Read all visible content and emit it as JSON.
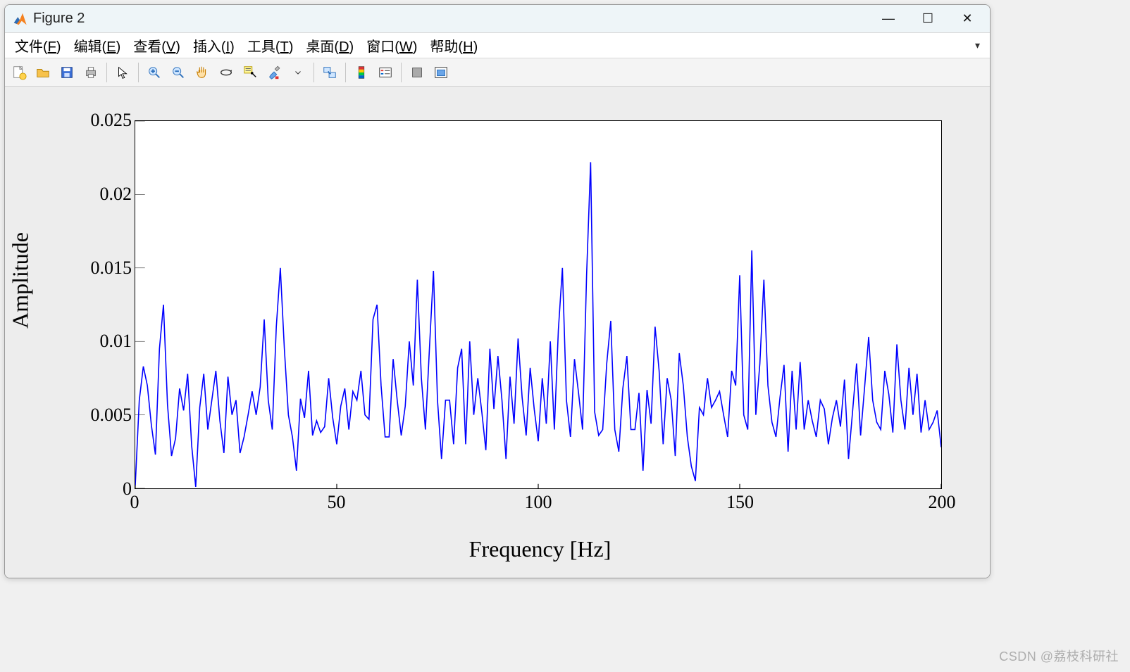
{
  "window": {
    "title": "Figure 2",
    "minimize": "—",
    "maximize": "☐",
    "close": "✕"
  },
  "menus": {
    "file": {
      "text": "文件(",
      "key": "F",
      "tail": ")"
    },
    "edit": {
      "text": "编辑(",
      "key": "E",
      "tail": ")"
    },
    "view": {
      "text": "查看(",
      "key": "V",
      "tail": ")"
    },
    "insert": {
      "text": "插入(",
      "key": "I",
      "tail": ")"
    },
    "tools": {
      "text": "工具(",
      "key": "T",
      "tail": ")"
    },
    "desktop": {
      "text": "桌面(",
      "key": "D",
      "tail": ")"
    },
    "windowm": {
      "text": "窗口(",
      "key": "W",
      "tail": ")"
    },
    "help": {
      "text": "帮助(",
      "key": "H",
      "tail": ")"
    }
  },
  "toolbar": {
    "new": "new-figure",
    "open": "open",
    "save": "save",
    "print": "print",
    "pointer": "pointer",
    "zoomin": "zoom-in",
    "zoomout": "zoom-out",
    "pan": "pan",
    "rotate": "rotate-3d",
    "datacursor": "data-cursor",
    "brush": "brush",
    "link": "link-plots",
    "colorbar": "insert-colorbar",
    "legend": "insert-legend",
    "hide": "hide-tools",
    "dock": "dock-figure"
  },
  "watermark": "CSDN @荔枝科研社",
  "chart_data": {
    "type": "line",
    "title": "",
    "xlabel": "Frequency [Hz]",
    "ylabel": "Amplitude",
    "xlim": [
      0,
      200
    ],
    "ylim": [
      0,
      0.025
    ],
    "xticks": [
      0,
      50,
      100,
      150,
      200
    ],
    "yticks": [
      0,
      0.005,
      0.01,
      0.015,
      0.02,
      0.025
    ],
    "ytick_labels": [
      "0",
      "0.005",
      "0.01",
      "0.015",
      "0.02",
      "0.025"
    ],
    "color": "#0000ff",
    "x": [
      0,
      1,
      2,
      3,
      4,
      5,
      6,
      7,
      8,
      9,
      10,
      11,
      12,
      13,
      14,
      15,
      16,
      17,
      18,
      19,
      20,
      21,
      22,
      23,
      24,
      25,
      26,
      27,
      28,
      29,
      30,
      31,
      32,
      33,
      34,
      35,
      36,
      37,
      38,
      39,
      40,
      41,
      42,
      43,
      44,
      45,
      46,
      47,
      48,
      49,
      50,
      51,
      52,
      53,
      54,
      55,
      56,
      57,
      58,
      59,
      60,
      61,
      62,
      63,
      64,
      65,
      66,
      67,
      68,
      69,
      70,
      71,
      72,
      73,
      74,
      75,
      76,
      77,
      78,
      79,
      80,
      81,
      82,
      83,
      84,
      85,
      86,
      87,
      88,
      89,
      90,
      91,
      92,
      93,
      94,
      95,
      96,
      97,
      98,
      99,
      100,
      101,
      102,
      103,
      104,
      105,
      106,
      107,
      108,
      109,
      110,
      111,
      112,
      113,
      114,
      115,
      116,
      117,
      118,
      119,
      120,
      121,
      122,
      123,
      124,
      125,
      126,
      127,
      128,
      129,
      130,
      131,
      132,
      133,
      134,
      135,
      136,
      137,
      138,
      139,
      140,
      141,
      142,
      143,
      144,
      145,
      146,
      147,
      148,
      149,
      150,
      151,
      152,
      153,
      154,
      155,
      156,
      157,
      158,
      159,
      160,
      161,
      162,
      163,
      164,
      165,
      166,
      167,
      168,
      169,
      170,
      171,
      172,
      173,
      174,
      175,
      176,
      177,
      178,
      179,
      180,
      181,
      182,
      183,
      184,
      185,
      186,
      187,
      188,
      189,
      190,
      191,
      192,
      193,
      194,
      195,
      196,
      197,
      198,
      199,
      200
    ],
    "y": [
      0.0002,
      0.006,
      0.0083,
      0.007,
      0.0043,
      0.0023,
      0.0095,
      0.0125,
      0.0057,
      0.0022,
      0.0034,
      0.0068,
      0.0053,
      0.0078,
      0.0029,
      0.0001,
      0.0055,
      0.0078,
      0.004,
      0.006,
      0.008,
      0.0046,
      0.0024,
      0.0076,
      0.005,
      0.006,
      0.0024,
      0.0035,
      0.005,
      0.0066,
      0.005,
      0.0069,
      0.0115,
      0.006,
      0.004,
      0.011,
      0.015,
      0.0095,
      0.005,
      0.0035,
      0.0012,
      0.0061,
      0.0048,
      0.008,
      0.0036,
      0.0046,
      0.0038,
      0.0042,
      0.0075,
      0.0048,
      0.003,
      0.0056,
      0.0068,
      0.004,
      0.0066,
      0.006,
      0.008,
      0.005,
      0.0047,
      0.0115,
      0.0125,
      0.007,
      0.0035,
      0.0035,
      0.0088,
      0.006,
      0.0036,
      0.0056,
      0.01,
      0.007,
      0.0142,
      0.0075,
      0.004,
      0.0095,
      0.0148,
      0.006,
      0.002,
      0.006,
      0.006,
      0.003,
      0.0082,
      0.0095,
      0.003,
      0.01,
      0.005,
      0.0075,
      0.0052,
      0.0026,
      0.0095,
      0.0054,
      0.009,
      0.006,
      0.002,
      0.0076,
      0.0044,
      0.0102,
      0.0062,
      0.0036,
      0.0082,
      0.0054,
      0.0032,
      0.0075,
      0.0044,
      0.01,
      0.004,
      0.0108,
      0.015,
      0.006,
      0.0035,
      0.0088,
      0.0065,
      0.004,
      0.0145,
      0.0222,
      0.0052,
      0.0036,
      0.004,
      0.0085,
      0.0114,
      0.004,
      0.0025,
      0.0068,
      0.009,
      0.004,
      0.004,
      0.0065,
      0.0012,
      0.0067,
      0.0044,
      0.011,
      0.008,
      0.003,
      0.0075,
      0.006,
      0.0022,
      0.0092,
      0.007,
      0.0035,
      0.0015,
      0.0005,
      0.0055,
      0.005,
      0.0075,
      0.0055,
      0.006,
      0.0066,
      0.005,
      0.0035,
      0.008,
      0.007,
      0.0145,
      0.005,
      0.004,
      0.0162,
      0.005,
      0.0085,
      0.0142,
      0.007,
      0.0045,
      0.0035,
      0.0062,
      0.0084,
      0.0025,
      0.008,
      0.004,
      0.0086,
      0.004,
      0.006,
      0.0046,
      0.0035,
      0.006,
      0.0054,
      0.003,
      0.0048,
      0.006,
      0.0042,
      0.0074,
      0.002,
      0.0052,
      0.0085,
      0.0036,
      0.0069,
      0.0103,
      0.006,
      0.0045,
      0.004,
      0.008,
      0.0064,
      0.0038,
      0.0098,
      0.006,
      0.004,
      0.0082,
      0.005,
      0.0078,
      0.0038,
      0.006,
      0.004,
      0.0045,
      0.0053,
      0.0028
    ]
  }
}
